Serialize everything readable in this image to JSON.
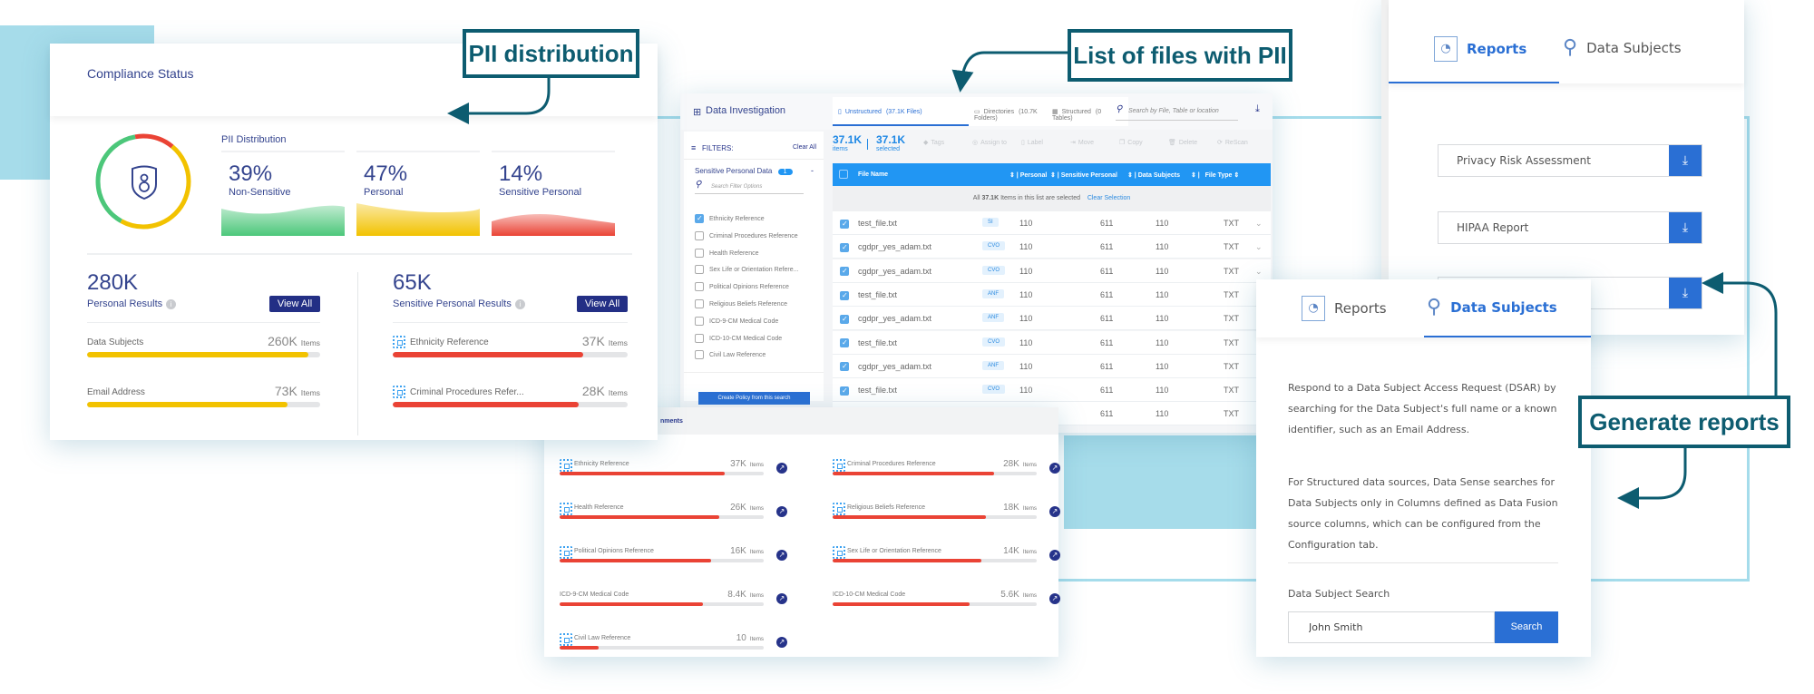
{
  "callouts": {
    "pii": "PII distribution",
    "files": "List of files with PII",
    "reports": "Generate reports"
  },
  "colors": {
    "callout": "#0d5c70",
    "accent_blue": "#2196f3",
    "navy": "#232f85",
    "green": "#4cc77a",
    "yellow": "#f2c200",
    "red": "#ea4335",
    "bg_blue": "#a6dcea"
  },
  "compliance": {
    "title": "Compliance Status",
    "pii_label": "PII Distribution",
    "distribution": [
      {
        "pct": "39%",
        "label": "Non-Sensitive",
        "value": 39,
        "color": "#4cc77a"
      },
      {
        "pct": "47%",
        "label": "Personal",
        "value": 47,
        "color": "#f2c200"
      },
      {
        "pct": "14%",
        "label": "Sensitive Personal",
        "value": 14,
        "color": "#ea4335"
      }
    ],
    "personal": {
      "count": "280K",
      "label": "Personal Results",
      "view_all": "View All",
      "items": [
        {
          "label": "Data Subjects",
          "count": "260K",
          "unit": "Items",
          "fill": 0.95
        },
        {
          "label": "Email Address",
          "count": "73K",
          "unit": "Items",
          "fill": 0.86
        }
      ]
    },
    "sensitive": {
      "count": "65K",
      "label": "Sensitive Personal Results",
      "view_all": "View All",
      "items": [
        {
          "label": "Ethnicity Reference",
          "count": "37K",
          "unit": "Items",
          "fill": 0.81
        },
        {
          "label": "Criminal Procedures Refer...",
          "count": "28K",
          "unit": "Items",
          "fill": 0.79
        }
      ]
    }
  },
  "investigation": {
    "title": "Data Investigation",
    "tabs": [
      {
        "label": "Unstructured",
        "count": "(37.1K Files)",
        "active": true
      },
      {
        "label": "Directories",
        "count": "(10.7K Folders)",
        "active": false
      },
      {
        "label": "Structured",
        "count": "(0 Tables)",
        "active": false
      }
    ],
    "search_placeholder": "Search by File, Table or location",
    "filters": {
      "label": "FILTERS:",
      "clear": "Clear All",
      "group": "Sensitive Personal Data",
      "group_count": "1",
      "group_toggle": "-",
      "search_placeholder": "Search Filter Options",
      "options": [
        {
          "label": "Ethnicity Reference",
          "checked": true
        },
        {
          "label": "Criminal Procedures Reference",
          "checked": false
        },
        {
          "label": "Health Reference",
          "checked": false
        },
        {
          "label": "Sex Life or Orientation Refere...",
          "checked": false
        },
        {
          "label": "Political Opinions Reference",
          "checked": false
        },
        {
          "label": "Religious Beliefs Reference",
          "checked": false
        },
        {
          "label": "ICD-9-CM Medical Code",
          "checked": false
        },
        {
          "label": "ICD-10-CM Medical Code",
          "checked": false
        },
        {
          "label": "Civil Law Reference",
          "checked": false
        }
      ],
      "create_policy": "Create Policy from this search"
    },
    "summary": {
      "items": "37.1K",
      "items_label": "items",
      "selected": "37.1K",
      "selected_label": "selected"
    },
    "actions": [
      "Tags",
      "Assign to",
      "Label",
      "Move",
      "Copy",
      "Delete",
      "ReScan"
    ],
    "columns": [
      "File Name",
      "Personal",
      "Sensitive Personal",
      "Data Subjects",
      "File Type"
    ],
    "selection": {
      "prefix": "All",
      "count": "37.1K",
      "suffix": "Items in this list are selected",
      "clear": "Clear Selection"
    },
    "rows": [
      {
        "file": "test_file.txt",
        "badge": "SI",
        "personal": "110",
        "sensitive": "611",
        "subjects": "110",
        "type": "TXT"
      },
      {
        "file": "cgdpr_yes_adam.txt",
        "badge": "CVO",
        "personal": "110",
        "sensitive": "611",
        "subjects": "110",
        "type": "TXT"
      },
      {
        "file": "cgdpr_yes_adam.txt",
        "badge": "CVO",
        "personal": "110",
        "sensitive": "611",
        "subjects": "110",
        "type": "TXT"
      },
      {
        "file": "test_file.txt",
        "badge": "ANF",
        "personal": "110",
        "sensitive": "611",
        "subjects": "110",
        "type": "TXT"
      },
      {
        "file": "cgdpr_yes_adam.txt",
        "badge": "ANF",
        "personal": "110",
        "sensitive": "611",
        "subjects": "110",
        "type": "TXT"
      },
      {
        "file": "test_file.txt",
        "badge": "CVO",
        "personal": "110",
        "sensitive": "611",
        "subjects": "110",
        "type": "TXT"
      },
      {
        "file": "cgdpr_yes_adam.txt",
        "badge": "ANF",
        "personal": "110",
        "sensitive": "611",
        "subjects": "110",
        "type": "TXT"
      },
      {
        "file": "test_file.txt",
        "badge": "CVO",
        "personal": "110",
        "sensitive": "611",
        "subjects": "110",
        "type": "TXT"
      },
      {
        "sensitive": "611",
        "subjects": "110",
        "type": "TXT"
      }
    ]
  },
  "environments": {
    "header": "nments",
    "items": [
      {
        "label": "Ethnicity Reference",
        "count": "37K",
        "unit": "Items",
        "fill": 0.81,
        "chip": true
      },
      {
        "label": "Criminal Procedures Reference",
        "count": "28K",
        "unit": "Items",
        "fill": 0.79,
        "chip": true
      },
      {
        "label": "Health Reference",
        "count": "26K",
        "unit": "Items",
        "fill": 0.78,
        "chip": true
      },
      {
        "label": "Religious Beliefs Reference",
        "count": "18K",
        "unit": "Items",
        "fill": 0.75,
        "chip": true
      },
      {
        "label": "Political Opinions Reference",
        "count": "16K",
        "unit": "Items",
        "fill": 0.74,
        "chip": true
      },
      {
        "label": "Sex Life or Orientation Reference",
        "count": "14K",
        "unit": "Items",
        "fill": 0.73,
        "chip": true
      },
      {
        "label": "ICD-9-CM Medical Code",
        "count": "8.4K",
        "unit": "Items",
        "fill": 0.7,
        "chip": false
      },
      {
        "label": "ICD-10-CM Medical Code",
        "count": "5.6K",
        "unit": "Items",
        "fill": 0.67,
        "chip": false
      },
      {
        "label": "Civil Law Reference",
        "count": "10",
        "unit": "Items",
        "fill": 0.19,
        "chip": true
      }
    ]
  },
  "reports": {
    "tabs": [
      {
        "label": "Reports",
        "icon": "report-icon"
      },
      {
        "label": "Data Subjects",
        "icon": "person-search-icon"
      }
    ],
    "active_tab": "Reports",
    "rows": [
      "Privacy Risk Assessment",
      "HIPAA Report",
      ""
    ]
  },
  "data_subjects": {
    "tabs": [
      {
        "label": "Reports"
      },
      {
        "label": "Data Subjects"
      }
    ],
    "active_tab": "Data Subjects",
    "paragraph1": "Respond to a Data Subject Access Request (DSAR) by searching for the Data Subject's full name or a known identifier, such as an Email Address.",
    "paragraph2": "For Structured data sources, Data Sense searches for Data Subjects only in Columns defined as Data Fusion source columns, which can be configured from the Configuration tab.",
    "search_label": "Data Subject Search",
    "search_value": "John Smith",
    "search_button": "Search"
  }
}
